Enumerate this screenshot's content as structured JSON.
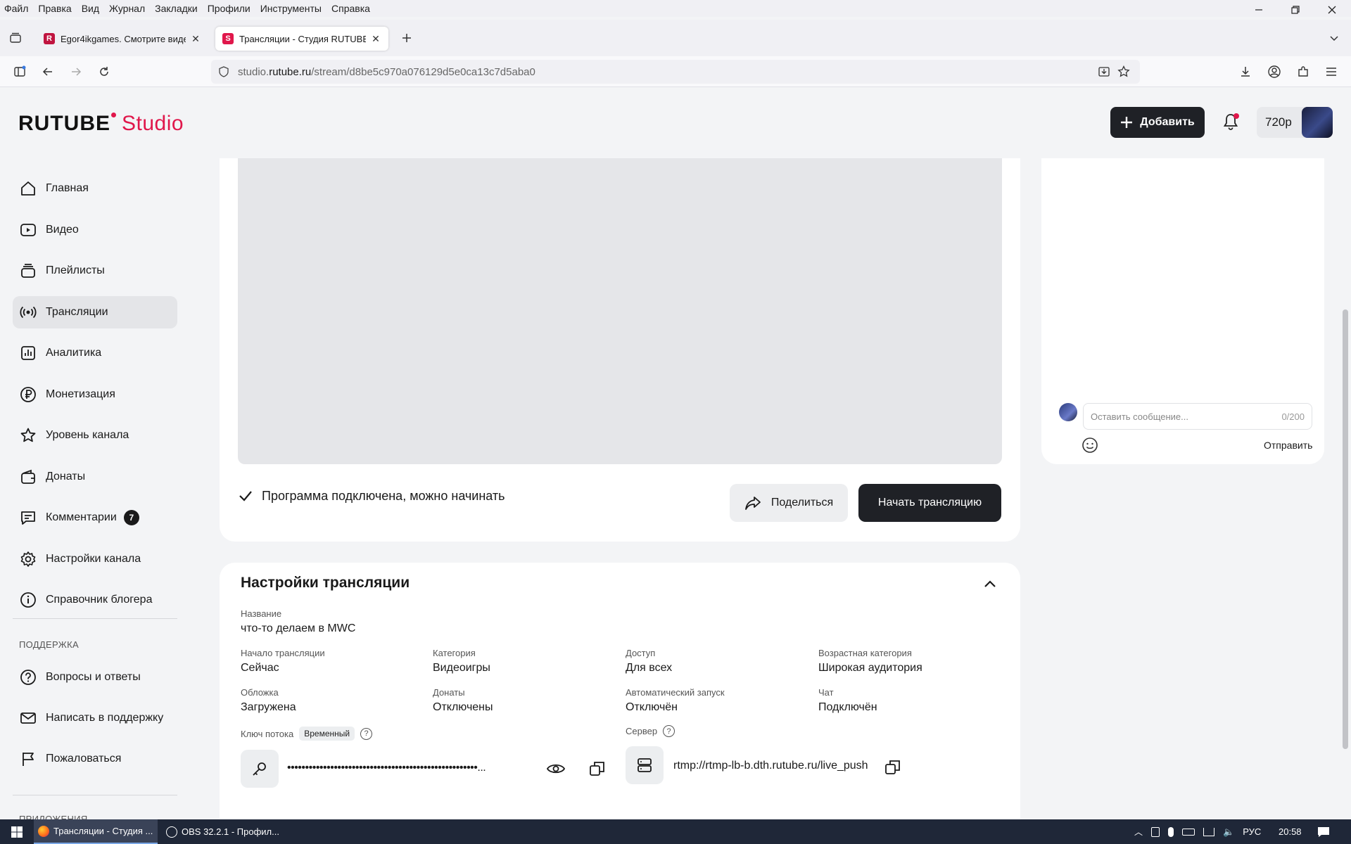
{
  "browser": {
    "menu": [
      "Файл",
      "Правка",
      "Вид",
      "Журнал",
      "Закладки",
      "Профили",
      "Инструменты",
      "Справка"
    ],
    "tabs": [
      {
        "label": "Egor4ikgames. Смотрите виде",
        "favicon": "R",
        "favicon_color": "#e0174b"
      },
      {
        "label": "Трансляции - Студия RUTUBE",
        "favicon": "S",
        "favicon_color": "#e0174b"
      }
    ],
    "url": {
      "prefix": "studio.",
      "host": "rutube.ru",
      "path": "/stream/d8be5c970a076129d5e0ca13c7d5aba0"
    }
  },
  "header": {
    "logo_main": "RUTUBE",
    "logo_sub": "Studio",
    "add_label": "Добавить",
    "quality": "720p",
    "brand_color": "#e0174b"
  },
  "sidebar": {
    "items": [
      {
        "label": "Главная",
        "icon": "home-icon"
      },
      {
        "label": "Видео",
        "icon": "video-icon"
      },
      {
        "label": "Плейлисты",
        "icon": "playlist-icon"
      },
      {
        "label": "Трансляции",
        "icon": "broadcast-icon",
        "active": true
      },
      {
        "label": "Аналитика",
        "icon": "analytics-icon"
      },
      {
        "label": "Монетизация",
        "icon": "ruble-icon"
      },
      {
        "label": "Уровень канала",
        "icon": "star-icon"
      },
      {
        "label": "Донаты",
        "icon": "wallet-icon"
      },
      {
        "label": "Комментарии",
        "icon": "comment-icon",
        "badge": "7"
      },
      {
        "label": "Настройки канала",
        "icon": "gear-icon"
      },
      {
        "label": "Справочник блогера",
        "icon": "info-icon"
      }
    ],
    "support_title": "ПОДДЕРЖКА",
    "support_items": [
      {
        "label": "Вопросы и ответы",
        "icon": "question-icon"
      },
      {
        "label": "Написать в поддержку",
        "icon": "mail-icon"
      },
      {
        "label": "Пожаловаться",
        "icon": "flag-icon"
      }
    ],
    "apps_title": "ПРИЛОЖЕНИЯ"
  },
  "stream": {
    "status": "Программа подключена, можно начинать",
    "share_label": "Поделиться",
    "start_label": "Начать трансляцию"
  },
  "settings": {
    "title": "Настройки трансляции",
    "name_label": "Название",
    "name_value": "что-то делаем в MWC",
    "fields": [
      {
        "label": "Начало трансляции",
        "value": "Сейчас"
      },
      {
        "label": "Категория",
        "value": "Видеоигры"
      },
      {
        "label": "Доступ",
        "value": "Для всех"
      },
      {
        "label": "Возрастная категория",
        "value": "Широкая аудитория"
      },
      {
        "label": "Обложка",
        "value": "Загружена"
      },
      {
        "label": "Донаты",
        "value": "Отключены"
      },
      {
        "label": "Автоматический запуск",
        "value": "Отключён"
      },
      {
        "label": "Чат",
        "value": "Подключён"
      }
    ],
    "key_label": "Ключ потока",
    "key_tag": "Временный",
    "key_value": "•••••••••••••••••••••••••••••••••••••••••••••••••••••...",
    "server_label": "Сервер",
    "server_value": "rtmp://rtmp-lb-b.dth.rutube.ru/live_push",
    "help": "?"
  },
  "chat": {
    "placeholder": "Оставить сообщение...",
    "counter": "0/200",
    "send_label": "Отправить"
  },
  "taskbar": {
    "items": [
      {
        "label": "Трансляции - Студия ..."
      },
      {
        "label": "OBS 32.2.1 - Профил..."
      }
    ],
    "lang": "РУС",
    "time": "20:58"
  }
}
